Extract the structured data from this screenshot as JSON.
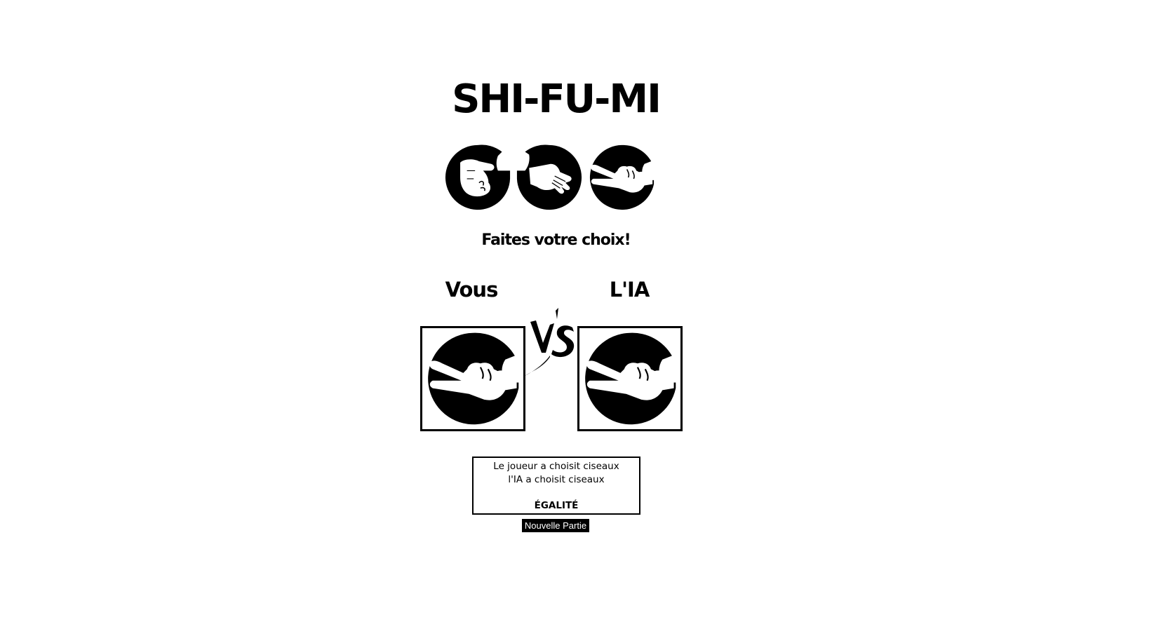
{
  "title": "SHI-FU-MI",
  "choices": [
    {
      "name": "pierre",
      "icon": "rock-fist-icon"
    },
    {
      "name": "feuille",
      "icon": "paper-hand-icon"
    },
    {
      "name": "ciseaux",
      "icon": "scissors-hand-icon"
    }
  ],
  "prompt": "Faites votre choix!",
  "players": {
    "player_label": "Vous",
    "ai_label": "L'IA",
    "player_choice_icon": "scissors-hand-icon",
    "ai_choice_icon": "scissors-hand-icon"
  },
  "vs_icon": "vs-brush-icon",
  "result": {
    "player_line": "Le joueur a choisit ciseaux",
    "ai_line": "l'IA a choisit ciseaux",
    "verdict": "ÉGALITÉ"
  },
  "new_game_label": "Nouvelle Partie",
  "colors": {
    "ink": "#000000",
    "background": "#ffffff",
    "button_bg": "#000000",
    "button_text": "#ffffff"
  }
}
